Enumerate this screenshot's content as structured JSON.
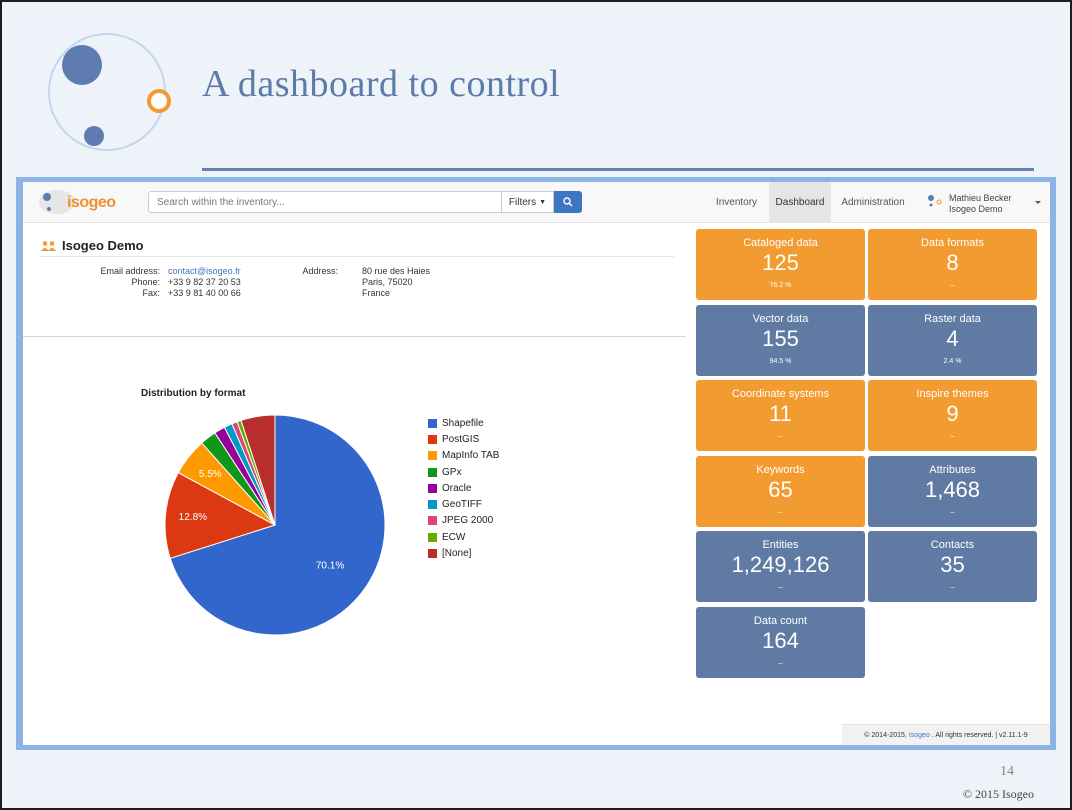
{
  "slide": {
    "title": "A dashboard to control",
    "page_number": "14",
    "footer_copyright": "© 2015 Isogeo"
  },
  "app": {
    "logo_text": "isogeo",
    "search": {
      "placeholder": "Search within the inventory..."
    },
    "filters_label": "Filters",
    "nav": {
      "inventory": "Inventory",
      "dashboard": "Dashboard",
      "administration": "Administration"
    },
    "active_tab": "Dashboard",
    "user": {
      "name": "Mathieu Becker",
      "org": "Isogeo Demo"
    }
  },
  "organization": {
    "name": "Isogeo Demo",
    "email_label": "Email address:",
    "email": "contact@isogeo.fr",
    "phone_label": "Phone:",
    "phone": "+33 9 82 37 20 53",
    "fax_label": "Fax:",
    "fax": "+33 9 81 40 00 66",
    "address_label": "Address:",
    "address_line1": "80 rue des Haies",
    "address_line2": "Paris, 75020",
    "address_line3": "France"
  },
  "chart_data": {
    "type": "pie",
    "title": "Distribution by format",
    "legend_position": "right",
    "slices": [
      {
        "name": "Shapefile",
        "value": 70.1,
        "color": "#3366cc",
        "label": "70.1%"
      },
      {
        "name": "PostGIS",
        "value": 12.8,
        "color": "#dc3912",
        "label": "12.8%"
      },
      {
        "name": "MapInfo TAB",
        "value": 5.5,
        "color": "#ff9900",
        "label": "5.5%"
      },
      {
        "name": "GPx",
        "value": 2.4,
        "color": "#109618",
        "label": ""
      },
      {
        "name": "Oracle",
        "value": 1.6,
        "color": "#990099",
        "label": ""
      },
      {
        "name": "GeoTIFF",
        "value": 1.2,
        "color": "#0099c6",
        "label": ""
      },
      {
        "name": "JPEG 2000",
        "value": 0.8,
        "color": "#dd4477",
        "label": ""
      },
      {
        "name": "ECW",
        "value": 0.6,
        "color": "#66aa00",
        "label": ""
      },
      {
        "name": "[None]",
        "value": 5.0,
        "color": "#b82e2e",
        "label": ""
      }
    ]
  },
  "tiles": [
    {
      "label": "Cataloged data",
      "value": "125",
      "sub": "76.2 %",
      "color": "orange"
    },
    {
      "label": "Data formats",
      "value": "8",
      "sub": "–",
      "color": "orange"
    },
    {
      "label": "Vector data",
      "value": "155",
      "sub": "94.5 %",
      "color": "blue"
    },
    {
      "label": "Raster data",
      "value": "4",
      "sub": "2.4 %",
      "color": "blue"
    },
    {
      "label": "Coordinate systems",
      "value": "11",
      "sub": "–",
      "color": "orange"
    },
    {
      "label": "Inspire themes",
      "value": "9",
      "sub": "–",
      "color": "orange"
    },
    {
      "label": "Keywords",
      "value": "65",
      "sub": "–",
      "color": "orange"
    },
    {
      "label": "Attributes",
      "value": "1,468",
      "sub": "–",
      "color": "blue"
    },
    {
      "label": "Entities",
      "value": "1,249,126",
      "sub": "–",
      "color": "blue"
    },
    {
      "label": "Contacts",
      "value": "35",
      "sub": "–",
      "color": "blue"
    },
    {
      "label": "Data count",
      "value": "164",
      "sub": "–",
      "color": "blue"
    }
  ],
  "footer": {
    "copyright_prefix": "© 2014-2015,",
    "copyright_link": "Isogeo",
    "copyright_suffix": ". All rights reserved. | v2.11.1-9"
  },
  "colors": {
    "accent_blue": "#3e76c2",
    "tile_orange": "#f29b30",
    "tile_blue": "#5f7aa3",
    "slide_title": "#5c7ba8",
    "frame": "#8bb3e4"
  }
}
